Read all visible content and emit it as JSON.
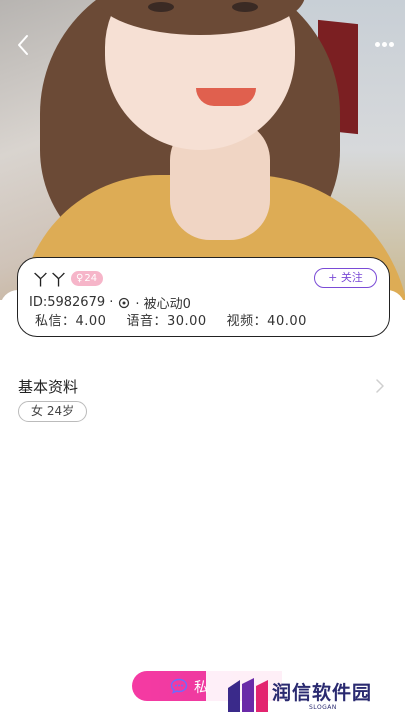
{
  "profile": {
    "name": "ㄚㄚ",
    "age_badge": "24",
    "age_badge_symbol": "♀",
    "follow_label": "+ 关注",
    "id_text": "ID:5982679 ·",
    "location_text": "· 被心动0",
    "prices": {
      "message": "私信：4.00",
      "voice": "语音：30.00",
      "video": "视频：40.00"
    }
  },
  "basic_info": {
    "title": "基本资料",
    "tag": "女 24岁"
  },
  "bottom": {
    "chat_label": "私"
  },
  "watermark": {
    "brand": "润信软件园",
    "slogan": "SLOGAN"
  },
  "colors": {
    "accent_purple": "#7a4bd6",
    "badge_pink": "#f6b5c9",
    "chat_pink": "#f53aa3",
    "watermark_navy": "#2a2a70"
  },
  "icons": {
    "back": "chevron-left-icon",
    "more": "more-dots-icon",
    "location": "location-pin-icon",
    "chevron": "chevron-right-icon",
    "chat": "chat-bubble-icon"
  }
}
